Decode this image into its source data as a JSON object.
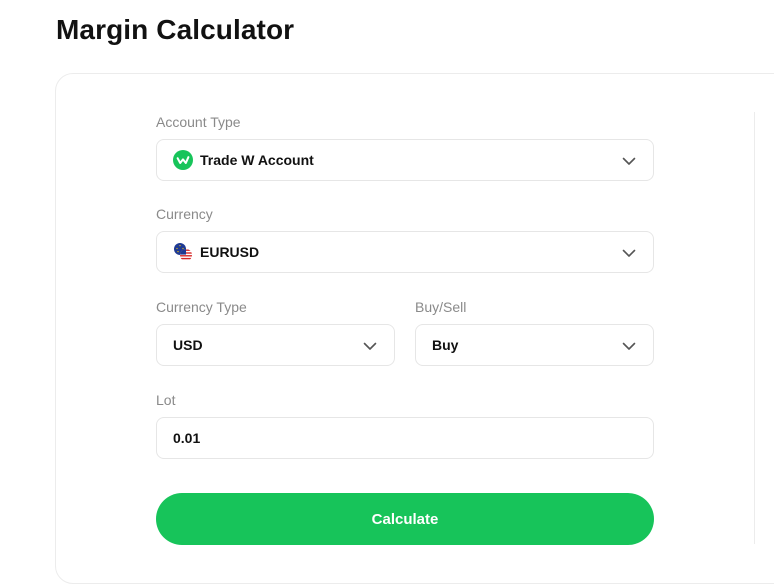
{
  "page": {
    "title": "Margin Calculator"
  },
  "form": {
    "account_type": {
      "label": "Account Type",
      "value": "Trade W Account",
      "icon": "trade-w-logo-icon"
    },
    "currency": {
      "label": "Currency",
      "value": "EURUSD",
      "icon": "eu-us-flag-icon"
    },
    "currency_type": {
      "label": "Currency Type",
      "value": "USD"
    },
    "buy_sell": {
      "label": "Buy/Sell",
      "value": "Buy"
    },
    "lot": {
      "label": "Lot",
      "value": "0.01"
    },
    "calculate_label": "Calculate"
  },
  "colors": {
    "accent": "#17c45a",
    "label": "#8a8a8a",
    "border": "#e6e6e6"
  }
}
